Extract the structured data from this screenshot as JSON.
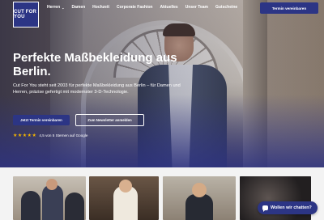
{
  "brand": {
    "logo_text": "CUT FOR YOU",
    "primary_color": "#2c3585"
  },
  "nav": {
    "items": [
      {
        "label": "Herren",
        "has_dropdown": true
      },
      {
        "label": "Damen"
      },
      {
        "label": "Hochzeit"
      },
      {
        "label": "Corporate Fashion"
      },
      {
        "label": "Aktuelles"
      },
      {
        "label": "Unser Team"
      },
      {
        "label": "Gutscheine"
      }
    ],
    "cta_label": "Termin vereinbaren"
  },
  "hero": {
    "headline": "Perfekte Maßbekleidung aus Berlin.",
    "intro": "Cut For You steht seit 2003 für perfekte Maßbekleidung aus Berlin – für Damen und Herren, präzise gefertigt mit modernster 3-D-Technologie.",
    "primary_button": "Jetzt Termin vereinbaren",
    "secondary_button": "Zum Newsletter anmelden",
    "rating": {
      "stars": "★★★★★",
      "value": 4.5,
      "text": "4,5 von 5 Sternen auf Google"
    }
  },
  "chat": {
    "label": "Wollen wir chatten?",
    "icon": "chat-bubble-icon"
  }
}
